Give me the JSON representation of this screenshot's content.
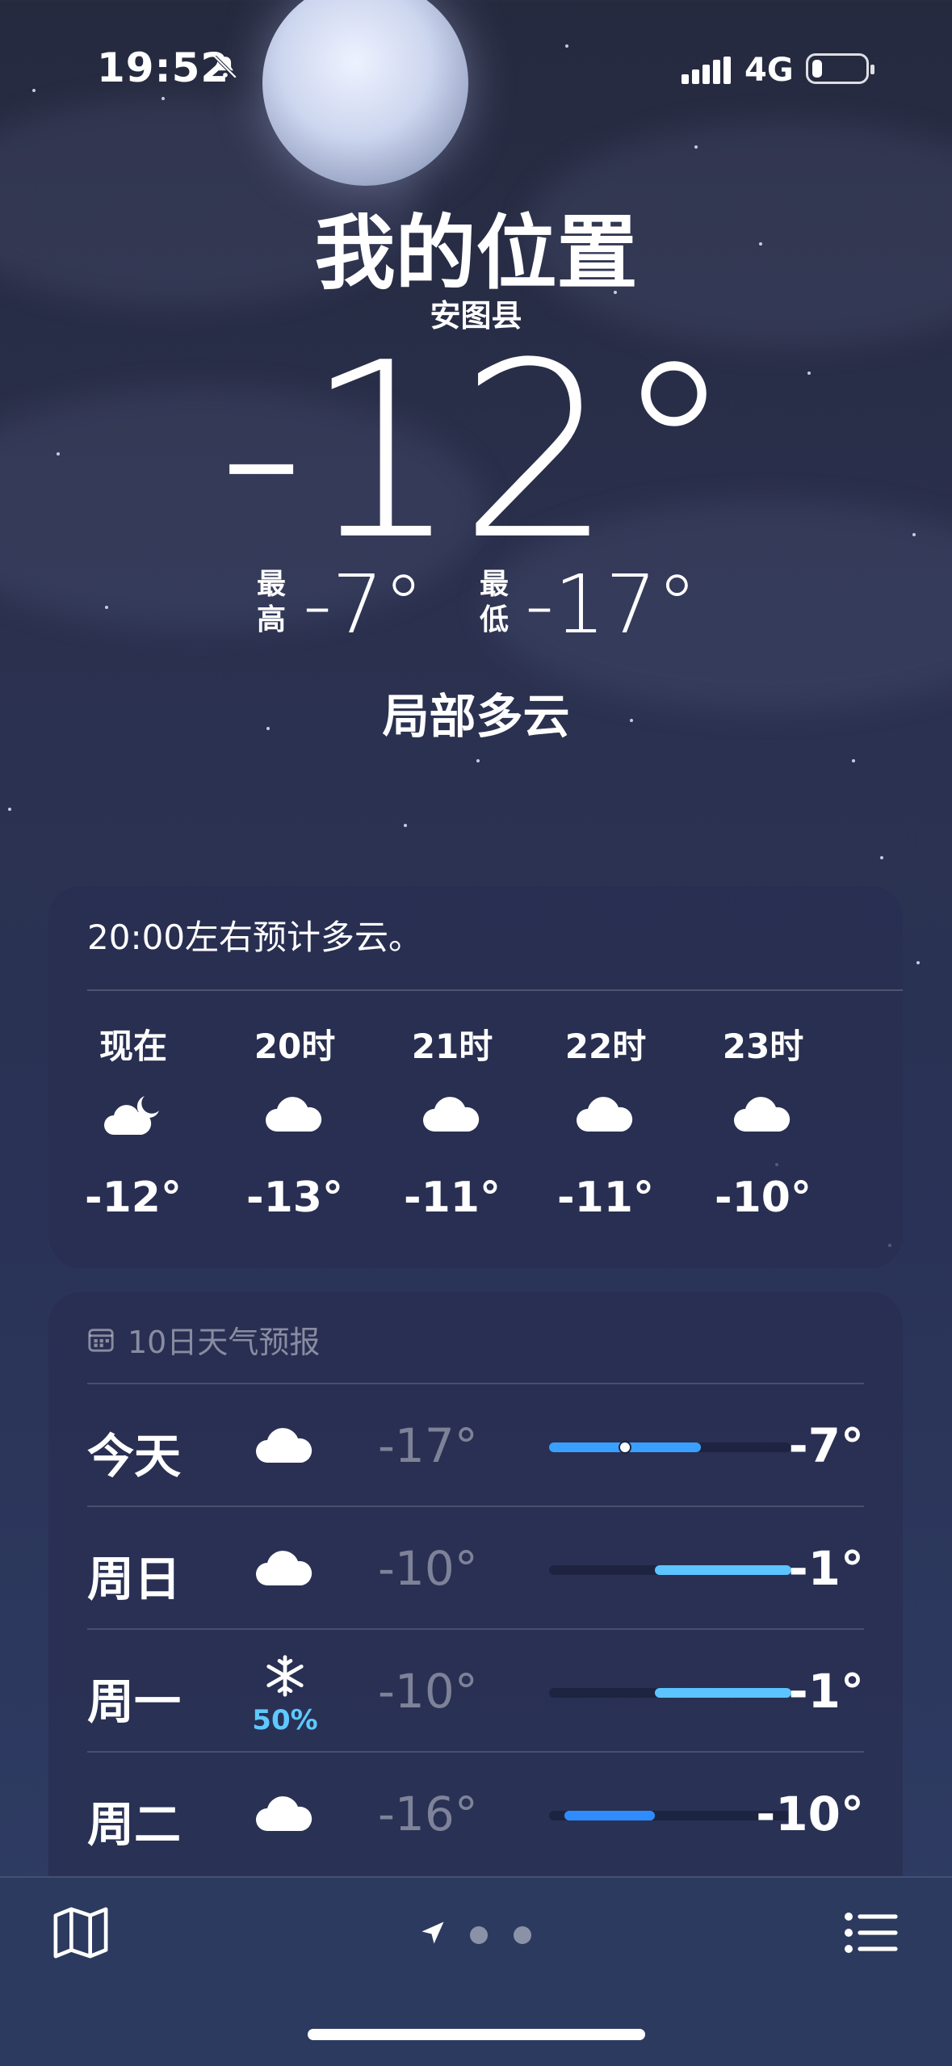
{
  "status": {
    "time": "19:52",
    "network": "4G"
  },
  "location": {
    "title": "我的位置",
    "county": "安图县"
  },
  "current": {
    "temp": "-12°",
    "high_label": "最高",
    "high": "-7°",
    "low_label": "最低",
    "low": "-17°",
    "condition": "局部多云"
  },
  "hourly": {
    "summary": "20:00左右预计多云。",
    "items": [
      {
        "label": "现在",
        "icon": "cloud-moon-icon",
        "temp": "-12°"
      },
      {
        "label": "20时",
        "icon": "cloud-icon",
        "temp": "-13°"
      },
      {
        "label": "21时",
        "icon": "cloud-icon",
        "temp": "-11°"
      },
      {
        "label": "22时",
        "icon": "cloud-icon",
        "temp": "-11°"
      },
      {
        "label": "23时",
        "icon": "cloud-icon",
        "temp": "-10°"
      }
    ]
  },
  "daily": {
    "header": "10日天气预报",
    "range_min": -17,
    "range_max": -1,
    "rows": [
      {
        "day": "今天",
        "icon": "cloud-icon",
        "precip": "",
        "low": "-17°",
        "high": "-7°",
        "low_val": -17,
        "high_val": -7,
        "current": -12,
        "color": "#3aa0ff"
      },
      {
        "day": "周日",
        "icon": "cloud-icon",
        "precip": "",
        "low": "-10°",
        "high": "-1°",
        "low_val": -10,
        "high_val": -1,
        "color": "#5cc4ff"
      },
      {
        "day": "周一",
        "icon": "snowflake-icon",
        "precip": "50%",
        "low": "-10°",
        "high": "-1°",
        "low_val": -10,
        "high_val": -1,
        "color": "#5cc4ff"
      },
      {
        "day": "周二",
        "icon": "cloud-icon",
        "precip": "",
        "low": "-16°",
        "high": "-10°",
        "low_val": -16,
        "high_val": -10,
        "color": "#2f8cff"
      }
    ]
  },
  "colors": {
    "accent": "#5ec9ff",
    "background": "#2b3150"
  }
}
